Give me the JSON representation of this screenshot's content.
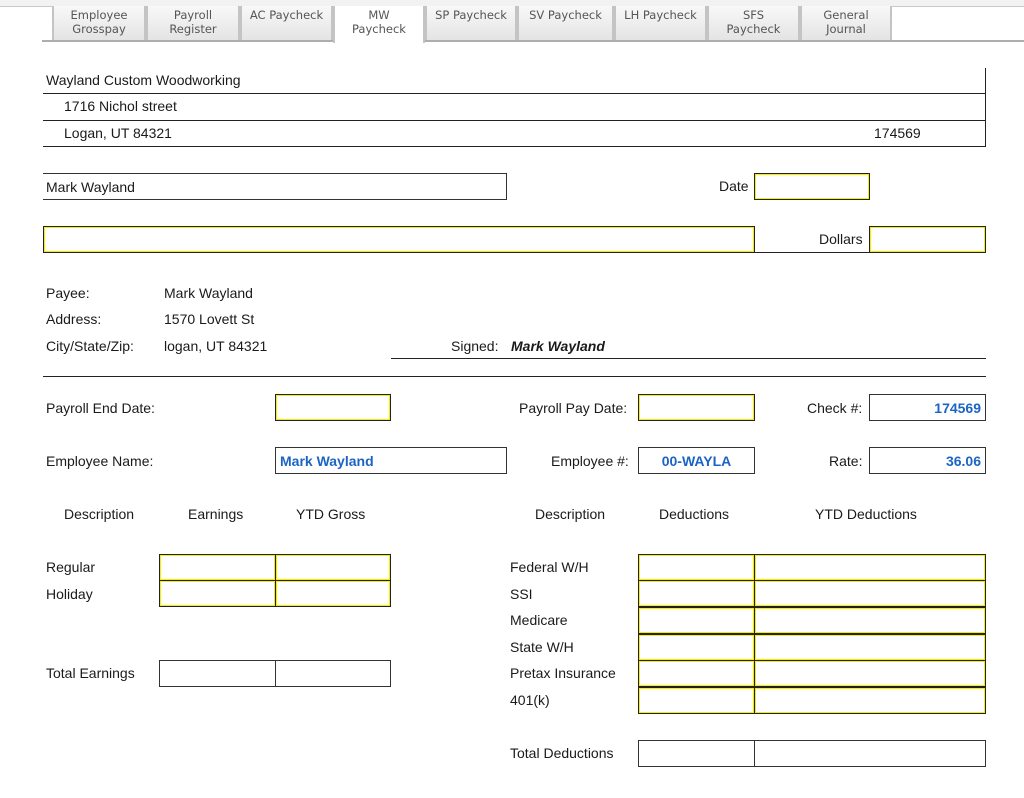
{
  "tabs": [
    {
      "label_line1": "Employee",
      "label_line2": "Grosspay",
      "active": false
    },
    {
      "label_line1": "Payroll",
      "label_line2": "Register",
      "active": false
    },
    {
      "label_line1": "AC Paycheck",
      "label_line2": "",
      "active": false
    },
    {
      "label_line1": "MW",
      "label_line2": "Paycheck",
      "active": true
    },
    {
      "label_line1": "SP Paycheck",
      "label_line2": "",
      "active": false
    },
    {
      "label_line1": "SV Paycheck",
      "label_line2": "",
      "active": false
    },
    {
      "label_line1": "LH Paycheck",
      "label_line2": "",
      "active": false
    },
    {
      "label_line1": "SFS",
      "label_line2": "Paycheck",
      "active": false
    },
    {
      "label_line1": "General",
      "label_line2": "Journal",
      "active": false
    }
  ],
  "check": {
    "company_name": "Wayland Custom Woodworking",
    "company_street": "1716 Nichol street",
    "company_city": "Logan, UT 84321",
    "check_number": "174569",
    "pay_to": "Mark Wayland",
    "date_label": "Date",
    "date_value": "",
    "amount_words": "",
    "dollars_label": "Dollars",
    "dollars_value": "",
    "payee_label": "Payee:",
    "payee_value": "Mark Wayland",
    "address_label": "Address:",
    "address_value": "1570 Lovett St",
    "city_label": "City/State/Zip:",
    "city_value": "logan, UT 84321",
    "signed_label": "Signed:",
    "signed_value": "Mark Wayland"
  },
  "stub": {
    "payroll_end_date_label": "Payroll End Date:",
    "payroll_end_date_value": "",
    "payroll_pay_date_label": "Payroll Pay Date:",
    "payroll_pay_date_value": "",
    "check_no_label": "Check #:",
    "check_no_value": "174569",
    "employee_name_label": "Employee Name:",
    "employee_name_value": "Mark Wayland",
    "employee_no_label": "Employee #:",
    "employee_no_value": "00-WAYLA",
    "rate_label": "Rate:",
    "rate_value": "36.06"
  },
  "earnings": {
    "headers": {
      "description": "Description",
      "earnings": "Earnings",
      "ytd": "YTD Gross"
    },
    "rows": [
      {
        "label": "Regular",
        "earnings": "",
        "ytd": ""
      },
      {
        "label": "Holiday",
        "earnings": "",
        "ytd": ""
      }
    ],
    "total_label": "Total Earnings",
    "total_earnings": "",
    "total_ytd": ""
  },
  "deductions": {
    "headers": {
      "description": "Description",
      "deductions": "Deductions",
      "ytd": "YTD Deductions"
    },
    "rows": [
      {
        "label": "Federal W/H",
        "amount": "",
        "ytd": ""
      },
      {
        "label": "SSI",
        "amount": "",
        "ytd": ""
      },
      {
        "label": "Medicare",
        "amount": "",
        "ytd": ""
      },
      {
        "label": "State W/H",
        "amount": "",
        "ytd": ""
      },
      {
        "label": "Pretax Insurance",
        "amount": "",
        "ytd": ""
      },
      {
        "label": "401(k)",
        "amount": "",
        "ytd": ""
      }
    ],
    "total_label": "Total Deductions",
    "total_amount": "",
    "total_ytd": ""
  },
  "colors": {
    "value_blue": "#1c64c4",
    "input_highlight": "#f5ee00"
  }
}
